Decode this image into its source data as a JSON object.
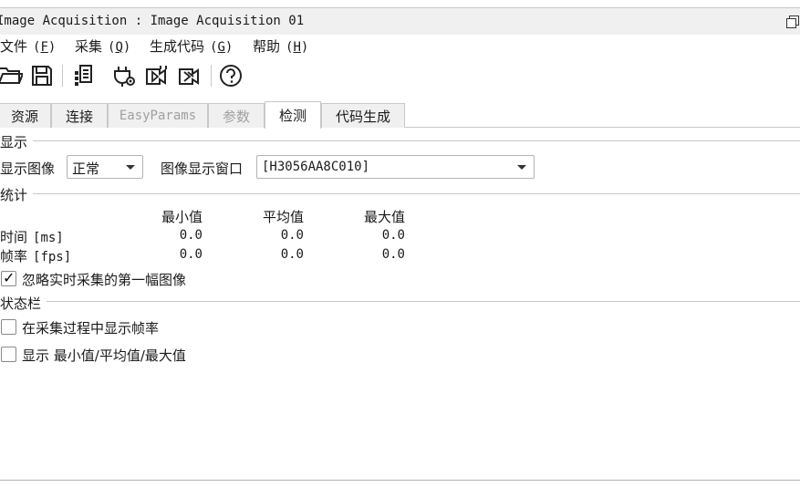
{
  "window": {
    "title": "Image Acquisition : Image Acquisition 01"
  },
  "menu": [
    {
      "label": "文件",
      "accel": "F"
    },
    {
      "label": "采集",
      "accel": "Q"
    },
    {
      "label": "生成代码",
      "accel": "G"
    },
    {
      "label": "帮助",
      "accel": "H"
    }
  ],
  "toolbar": [
    {
      "icon": "open-folder-icon"
    },
    {
      "icon": "save-icon"
    },
    {
      "icon": "device-properties-icon"
    },
    {
      "icon": "settings-plug-icon"
    },
    {
      "icon": "snap-icon"
    },
    {
      "icon": "live-icon"
    },
    {
      "icon": "help-icon"
    }
  ],
  "tabs": [
    {
      "label": "资源",
      "state": "normal"
    },
    {
      "label": "连接",
      "state": "normal"
    },
    {
      "label": "EasyParams",
      "state": "disabled"
    },
    {
      "label": "参数",
      "state": "disabled"
    },
    {
      "label": "检测",
      "state": "active"
    },
    {
      "label": "代码生成",
      "state": "normal"
    }
  ],
  "display": {
    "group_label": "显示",
    "image_label": "显示图像",
    "image_value": "正常",
    "window_label": "图像显示窗口",
    "window_value": "[H3056AA8C010]"
  },
  "stats": {
    "group_label": "统计",
    "columns": [
      "最小值",
      "平均值",
      "最大值"
    ],
    "rows": [
      {
        "label": "时间",
        "unit": "[ms]",
        "values": [
          "0.0",
          "0.0",
          "0.0"
        ]
      },
      {
        "label": "帧率",
        "unit": "[fps]",
        "values": [
          "0.0",
          "0.0",
          "0.0"
        ]
      }
    ],
    "ignore_first_label": "忽略实时采集的第一幅图像",
    "ignore_first_checked": true
  },
  "statusbar": {
    "group_label": "状态栏",
    "show_fps_label": "在采集过程中显示帧率",
    "show_fps_checked": false,
    "show_minmax_label": "显示 最小值/平均值/最大值",
    "show_minmax_checked": false
  }
}
